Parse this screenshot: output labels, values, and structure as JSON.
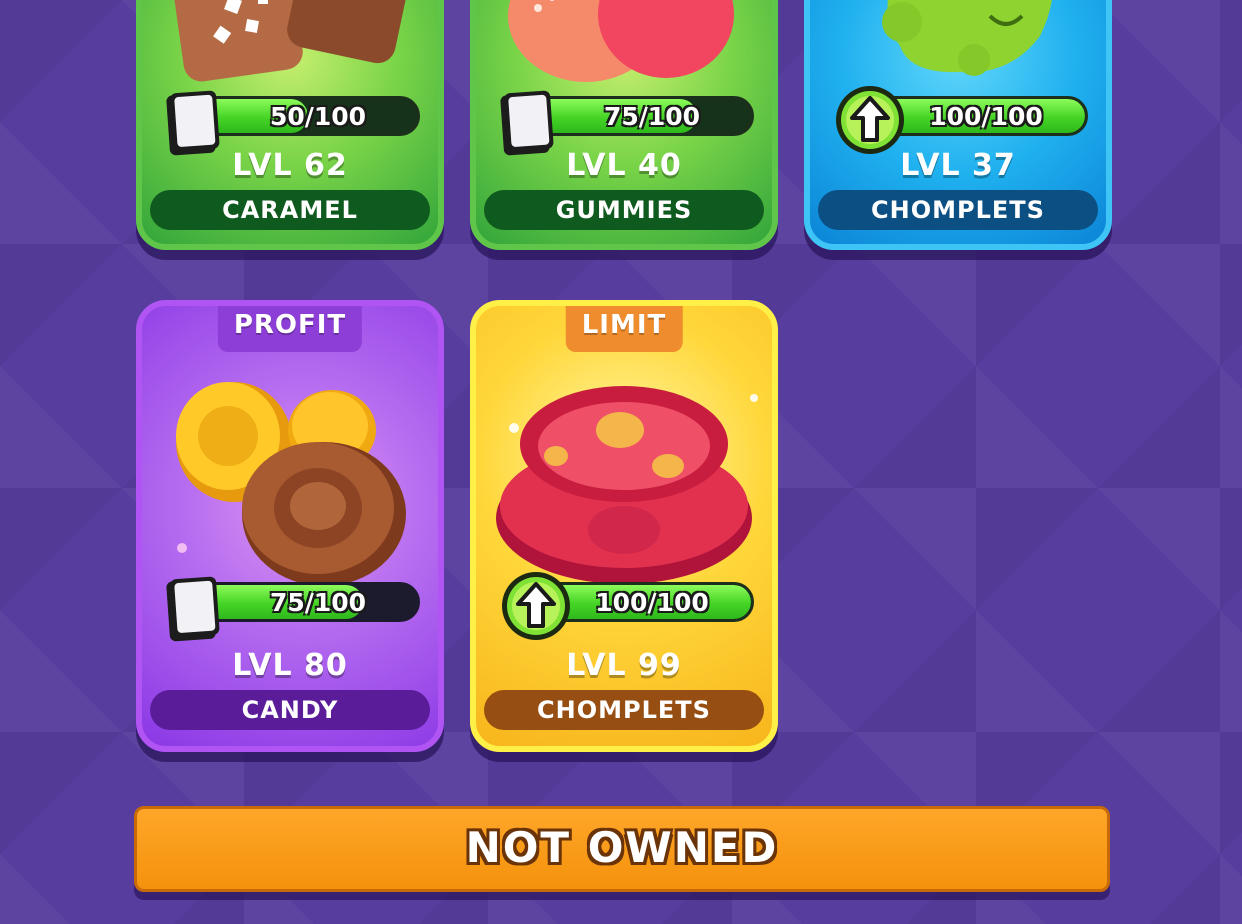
{
  "cards": [
    {
      "id": "caramel",
      "name": "CARAMEL",
      "level": "LVL 62",
      "progress_text": "50/100",
      "progress": 0.5,
      "can_upgrade": false,
      "theme": "green"
    },
    {
      "id": "gummies",
      "name": "GUMMIES",
      "level": "LVL 40",
      "progress_text": "75/100",
      "progress": 0.75,
      "can_upgrade": false,
      "theme": "green"
    },
    {
      "id": "chomplets-top",
      "name": "CHOMPLETS",
      "level": "LVL 37",
      "progress_text": "100/100",
      "progress": 1.0,
      "can_upgrade": true,
      "theme": "blue"
    },
    {
      "id": "candy",
      "tag": "PROFIT",
      "name": "CANDY",
      "level": "LVL 80",
      "progress_text": "75/100",
      "progress": 0.75,
      "can_upgrade": false,
      "theme": "purple"
    },
    {
      "id": "chomplets-bottom",
      "tag": "LIMIT",
      "name": "CHOMPLETS",
      "level": "LVL 99",
      "progress_text": "100/100",
      "progress": 1.0,
      "can_upgrade": true,
      "theme": "yellow"
    }
  ],
  "status_button": {
    "label": "NOT OWNED"
  },
  "colors": {
    "background": "#573d9e",
    "green_card": "#5fc64a",
    "blue_card": "#3ec5f6",
    "purple_card": "#b054f3",
    "yellow_card": "#fff047",
    "progress_fill": "#45d426",
    "button": "#f4920c"
  },
  "icons": {
    "card_count": "card-stack-icon",
    "upgrade": "upgrade-arrow-icon"
  }
}
